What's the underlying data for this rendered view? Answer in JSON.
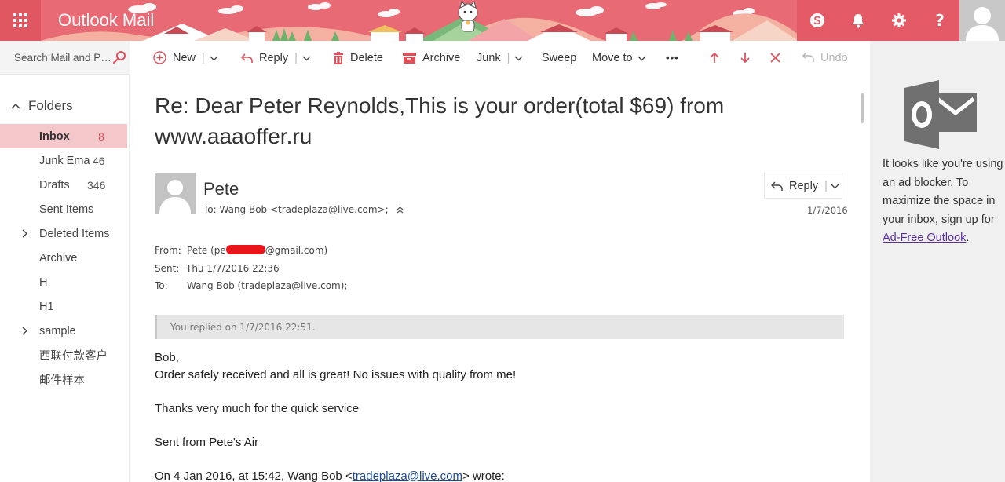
{
  "header": {
    "app_title": "Outlook Mail",
    "icons": [
      "waffle-icon",
      "skype-icon",
      "bell-icon",
      "gear-icon",
      "help-icon",
      "user-avatar"
    ],
    "help_glyph": "?",
    "brand_color": "#e86a74"
  },
  "toolbar": {
    "search_placeholder": "Search Mail and People",
    "new_label": "New",
    "reply_label": "Reply",
    "delete_label": "Delete",
    "archive_label": "Archive",
    "junk_label": "Junk",
    "sweep_label": "Sweep",
    "move_to_label": "Move to",
    "more_label": "•••",
    "undo_label": "Undo",
    "sep": "|"
  },
  "folders": {
    "header": "Folders",
    "items": [
      {
        "name": "Inbox",
        "count": "8"
      },
      {
        "name": "Junk Ema",
        "count": "46"
      },
      {
        "name": "Drafts",
        "count": "346"
      },
      {
        "name": "Sent Items",
        "count": ""
      },
      {
        "name": "Deleted Items",
        "count": ""
      },
      {
        "name": "Archive",
        "count": ""
      },
      {
        "name": "H",
        "count": ""
      },
      {
        "name": "H1",
        "count": ""
      },
      {
        "name": "sample",
        "count": ""
      },
      {
        "name": "西联付款客户",
        "count": ""
      },
      {
        "name": "邮件样本",
        "count": ""
      }
    ]
  },
  "message": {
    "subject": "Re: Dear Peter Reynolds,This is your order(total $69) from www.aaaoffer.ru",
    "sender_name": "Pete",
    "to_line": "To: Wang Bob <tradeplaza@live.com>;",
    "reply_label": "Reply",
    "date": "1/7/2016",
    "from_label": "From:",
    "from_prefix": "Pete (pe",
    "from_suffix": "@gmail.com)",
    "sent_label": "Sent:",
    "sent_value": "Thu 1/7/2016 22:36",
    "to_label": "To:",
    "to_value": "Wang Bob (tradeplaza@live.com);",
    "replied_notice": "You replied on 1/7/2016 22:51.",
    "body": {
      "greeting": "Bob,",
      "line1": "Order safely received and all is great! No issues with quality from me!",
      "line2": "Thanks very much for the quick service",
      "line3": "Sent from Pete's Air",
      "quote_prefix": "On 4 Jan 2016, at 15:42, Wang Bob <",
      "quote_link": "tradeplaza@live.com",
      "quote_suffix": "> wrote:"
    }
  },
  "ad_pane": {
    "text": "It looks like you're using an ad blocker. To maximize the space in your inbox, sign up for",
    "link": "Ad-Free Outlook",
    "suffix": "."
  }
}
